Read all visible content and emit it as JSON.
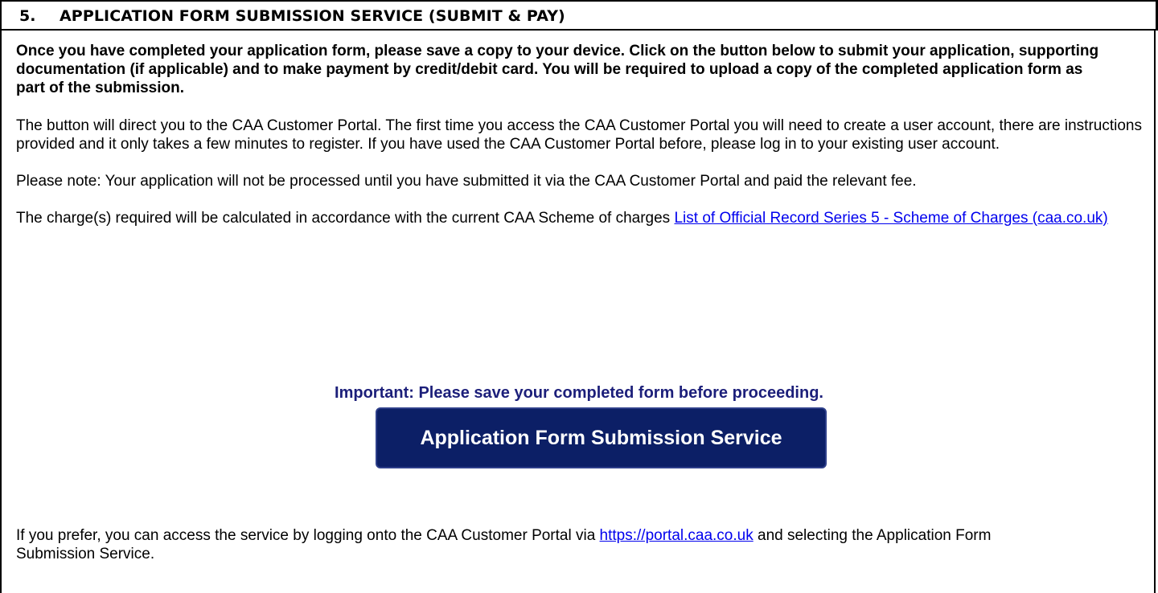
{
  "section": {
    "number": "5.",
    "title": "APPLICATION FORM SUBMISSION SERVICE (SUBMIT & PAY)"
  },
  "intro_text": "Once you have completed your application form, please save a copy to your device. Click on the button below to submit your application, supporting documentation (if applicable) and to make payment by credit/debit card. You will be required to upload a copy of the completed application form as part of the submission.",
  "portal_paragraph": "The button will direct you to the CAA Customer Portal. The first time you access the CAA Customer Portal you will need to create a user account, there are instructions provided and it only takes a few minutes to register.  If you have used the CAA Customer Portal before, please log in to your existing user account.",
  "note_paragraph": "Please note: Your application will not be processed until you have submitted it via the CAA Customer Portal and paid the relevant fee.",
  "charges": {
    "text": "The charge(s) required will be calculated in accordance with the current CAA Scheme of charges ",
    "link_text": "List of Official Record Series 5 - Scheme of Charges (caa.co.uk)"
  },
  "important_notice": "Important: Please save your completed form before proceeding.",
  "submit_button_label": "Application Form Submission Service",
  "alternative": {
    "text_before": "If you prefer, you can access the service by logging onto the CAA Customer Portal via ",
    "link_text": "https://portal.caa.co.uk",
    "text_after": " and selecting the Application Form Submission Service."
  },
  "colors": {
    "button_background": "#0c1f66",
    "important_text": "#1c1f7a",
    "link": "#0000ee"
  }
}
